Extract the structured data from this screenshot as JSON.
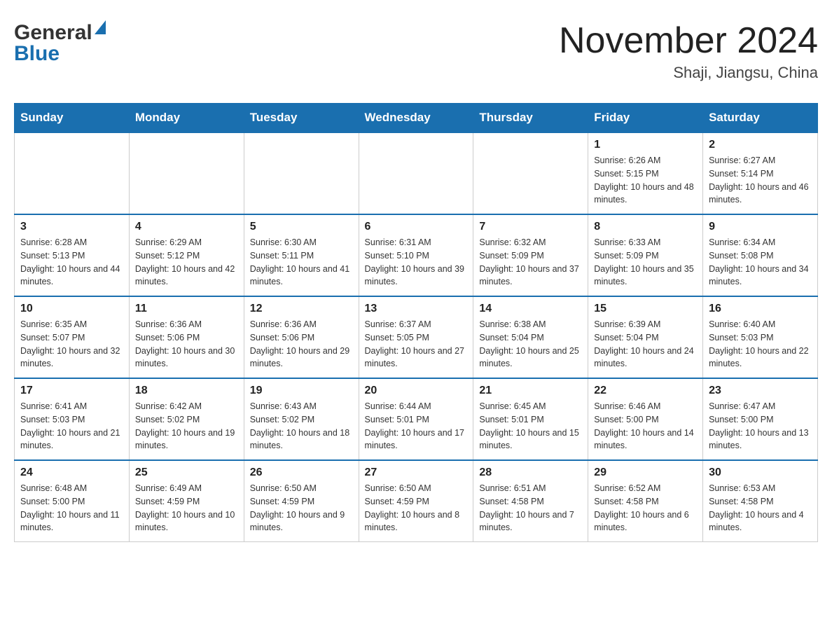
{
  "header": {
    "logo_general": "General",
    "logo_blue": "Blue",
    "title": "November 2024",
    "subtitle": "Shaji, Jiangsu, China"
  },
  "weekdays": [
    "Sunday",
    "Monday",
    "Tuesday",
    "Wednesday",
    "Thursday",
    "Friday",
    "Saturday"
  ],
  "weeks": [
    [
      {
        "day": "",
        "info": ""
      },
      {
        "day": "",
        "info": ""
      },
      {
        "day": "",
        "info": ""
      },
      {
        "day": "",
        "info": ""
      },
      {
        "day": "",
        "info": ""
      },
      {
        "day": "1",
        "info": "Sunrise: 6:26 AM\nSunset: 5:15 PM\nDaylight: 10 hours and 48 minutes."
      },
      {
        "day": "2",
        "info": "Sunrise: 6:27 AM\nSunset: 5:14 PM\nDaylight: 10 hours and 46 minutes."
      }
    ],
    [
      {
        "day": "3",
        "info": "Sunrise: 6:28 AM\nSunset: 5:13 PM\nDaylight: 10 hours and 44 minutes."
      },
      {
        "day": "4",
        "info": "Sunrise: 6:29 AM\nSunset: 5:12 PM\nDaylight: 10 hours and 42 minutes."
      },
      {
        "day": "5",
        "info": "Sunrise: 6:30 AM\nSunset: 5:11 PM\nDaylight: 10 hours and 41 minutes."
      },
      {
        "day": "6",
        "info": "Sunrise: 6:31 AM\nSunset: 5:10 PM\nDaylight: 10 hours and 39 minutes."
      },
      {
        "day": "7",
        "info": "Sunrise: 6:32 AM\nSunset: 5:09 PM\nDaylight: 10 hours and 37 minutes."
      },
      {
        "day": "8",
        "info": "Sunrise: 6:33 AM\nSunset: 5:09 PM\nDaylight: 10 hours and 35 minutes."
      },
      {
        "day": "9",
        "info": "Sunrise: 6:34 AM\nSunset: 5:08 PM\nDaylight: 10 hours and 34 minutes."
      }
    ],
    [
      {
        "day": "10",
        "info": "Sunrise: 6:35 AM\nSunset: 5:07 PM\nDaylight: 10 hours and 32 minutes."
      },
      {
        "day": "11",
        "info": "Sunrise: 6:36 AM\nSunset: 5:06 PM\nDaylight: 10 hours and 30 minutes."
      },
      {
        "day": "12",
        "info": "Sunrise: 6:36 AM\nSunset: 5:06 PM\nDaylight: 10 hours and 29 minutes."
      },
      {
        "day": "13",
        "info": "Sunrise: 6:37 AM\nSunset: 5:05 PM\nDaylight: 10 hours and 27 minutes."
      },
      {
        "day": "14",
        "info": "Sunrise: 6:38 AM\nSunset: 5:04 PM\nDaylight: 10 hours and 25 minutes."
      },
      {
        "day": "15",
        "info": "Sunrise: 6:39 AM\nSunset: 5:04 PM\nDaylight: 10 hours and 24 minutes."
      },
      {
        "day": "16",
        "info": "Sunrise: 6:40 AM\nSunset: 5:03 PM\nDaylight: 10 hours and 22 minutes."
      }
    ],
    [
      {
        "day": "17",
        "info": "Sunrise: 6:41 AM\nSunset: 5:03 PM\nDaylight: 10 hours and 21 minutes."
      },
      {
        "day": "18",
        "info": "Sunrise: 6:42 AM\nSunset: 5:02 PM\nDaylight: 10 hours and 19 minutes."
      },
      {
        "day": "19",
        "info": "Sunrise: 6:43 AM\nSunset: 5:02 PM\nDaylight: 10 hours and 18 minutes."
      },
      {
        "day": "20",
        "info": "Sunrise: 6:44 AM\nSunset: 5:01 PM\nDaylight: 10 hours and 17 minutes."
      },
      {
        "day": "21",
        "info": "Sunrise: 6:45 AM\nSunset: 5:01 PM\nDaylight: 10 hours and 15 minutes."
      },
      {
        "day": "22",
        "info": "Sunrise: 6:46 AM\nSunset: 5:00 PM\nDaylight: 10 hours and 14 minutes."
      },
      {
        "day": "23",
        "info": "Sunrise: 6:47 AM\nSunset: 5:00 PM\nDaylight: 10 hours and 13 minutes."
      }
    ],
    [
      {
        "day": "24",
        "info": "Sunrise: 6:48 AM\nSunset: 5:00 PM\nDaylight: 10 hours and 11 minutes."
      },
      {
        "day": "25",
        "info": "Sunrise: 6:49 AM\nSunset: 4:59 PM\nDaylight: 10 hours and 10 minutes."
      },
      {
        "day": "26",
        "info": "Sunrise: 6:50 AM\nSunset: 4:59 PM\nDaylight: 10 hours and 9 minutes."
      },
      {
        "day": "27",
        "info": "Sunrise: 6:50 AM\nSunset: 4:59 PM\nDaylight: 10 hours and 8 minutes."
      },
      {
        "day": "28",
        "info": "Sunrise: 6:51 AM\nSunset: 4:58 PM\nDaylight: 10 hours and 7 minutes."
      },
      {
        "day": "29",
        "info": "Sunrise: 6:52 AM\nSunset: 4:58 PM\nDaylight: 10 hours and 6 minutes."
      },
      {
        "day": "30",
        "info": "Sunrise: 6:53 AM\nSunset: 4:58 PM\nDaylight: 10 hours and 4 minutes."
      }
    ]
  ]
}
